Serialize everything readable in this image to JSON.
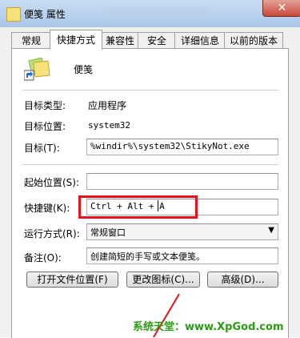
{
  "window": {
    "title": "便笺 属性",
    "close_label": "✕"
  },
  "tabs": [
    {
      "label": "常规"
    },
    {
      "label": "快捷方式"
    },
    {
      "label": "兼容性"
    },
    {
      "label": "安全"
    },
    {
      "label": "详细信息"
    },
    {
      "label": "以前的版本"
    }
  ],
  "app": {
    "name": "便笺",
    "icon": "sticky-notes-shortcut-icon"
  },
  "info": {
    "target_type_label": "目标类型:",
    "target_type_value": "应用程序",
    "target_location_label": "目标位置:",
    "target_location_value": "system32",
    "target_label": "目标(T):",
    "target_value": "%windir%\\system32\\StikyNot.exe"
  },
  "fields": {
    "start_in_label": "起始位置(S):",
    "start_in_value": "",
    "shortcut_key_label": "快捷键(K):",
    "shortcut_key_value": "Ctrl + Alt + A",
    "run_label": "运行方式(R):",
    "run_value": "常规窗口",
    "comment_label": "备注(O):",
    "comment_value": "创建简短的手写或文本便笺。"
  },
  "buttons": {
    "open_location": "打开文件位置(F)",
    "change_icon": "更改图标(C)...",
    "advanced": "高级(D)..."
  },
  "watermark": "系统天堂：www.XpGod.com",
  "colors": {
    "highlight": "#e0151d",
    "watermark": "#2d9a15"
  }
}
